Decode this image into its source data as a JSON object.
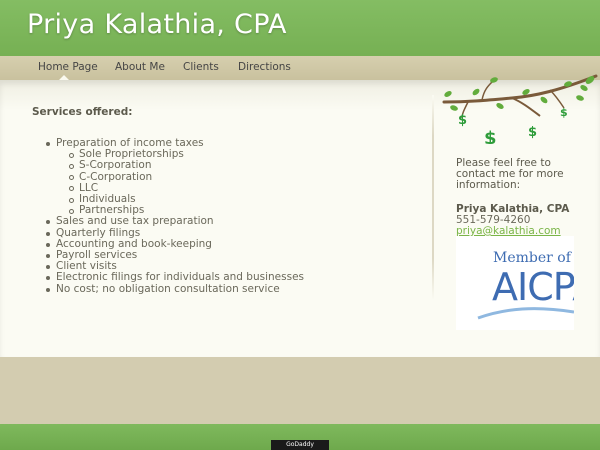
{
  "header": {
    "title": "Priya Kalathia, CPA"
  },
  "nav": {
    "items": [
      "Home Page",
      "About Me",
      "Clients",
      "Directions"
    ],
    "active": "Home Page"
  },
  "main": {
    "heading": "Services offered:",
    "services": [
      {
        "label": "Preparation of income taxes",
        "sub": [
          "Sole Proprietorships",
          "S-Corporation",
          "C-Corporation",
          "LLC",
          "Individuals",
          "Partnerships"
        ]
      },
      {
        "label": "Sales and use tax preparation"
      },
      {
        "label": "Quarterly filings"
      },
      {
        "label": "Accounting and book-keeping"
      },
      {
        "label": "Payroll services"
      },
      {
        "label": "Client visits"
      },
      {
        "label": "Electronic filings for individuals and businesses"
      },
      {
        "label": "No cost; no obligation consultation service"
      }
    ]
  },
  "sidebar": {
    "intro_line1": "Please feel free to",
    "intro_line2": "contact me for more",
    "intro_line3": "information:",
    "name": "Priya Kalathia, CPA",
    "phone": "551-579-4260",
    "email": "priya@kalathia.com",
    "badge": {
      "member": "Member of",
      "org": "AICPA"
    }
  },
  "footer": {
    "badge": "GoDaddy"
  },
  "colors": {
    "header_green": "#7ab556",
    "nav_bg": "#d2cbaa",
    "content_bg": "#fbfbf3",
    "body_tan": "#d3ccb0",
    "link_green": "#7ab548",
    "aicpa_blue": "#3e6cb2"
  }
}
